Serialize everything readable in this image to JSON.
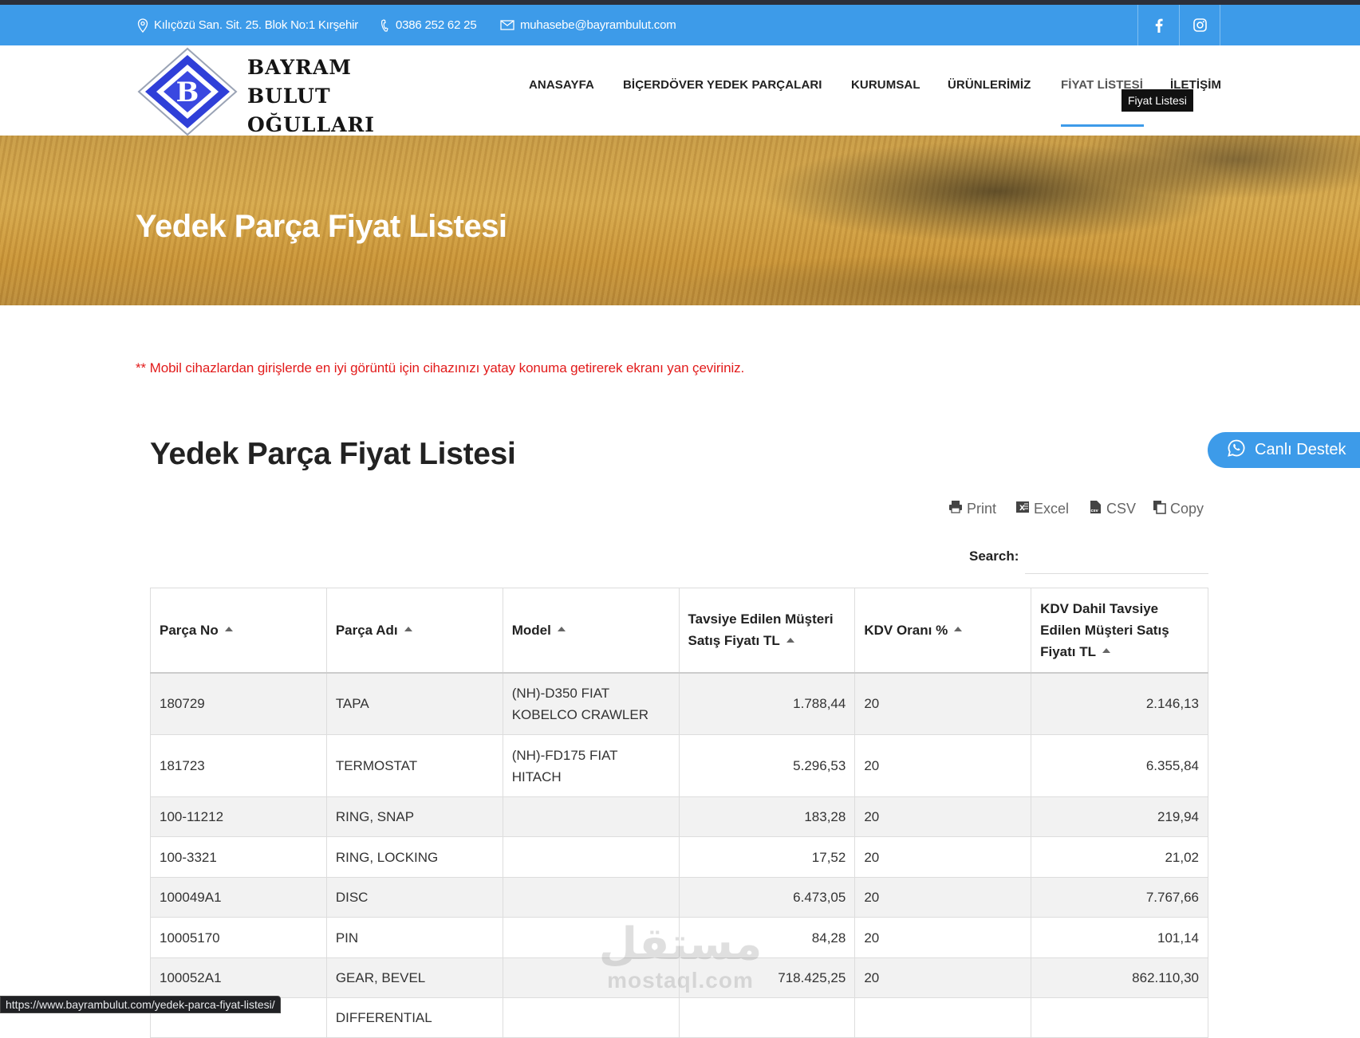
{
  "topbar": {
    "address": "Kılıçözü San. Sit. 25. Blok No:1 Kırşehir",
    "phone": "0386 252 62 25",
    "email": "muhasebe@bayrambulut.com",
    "social": [
      "facebook-icon",
      "instagram-icon"
    ]
  },
  "logo": {
    "letter": "B",
    "lines": [
      "BAYRAM",
      "BULUT",
      "OĞULLARI"
    ]
  },
  "nav": {
    "items": [
      "ANASAYFA",
      "BİÇERDÖVER YEDEK PARÇALARI",
      "KURUMSAL",
      "ÜRÜNLERİMİZ",
      "FİYAT LİSTESİ",
      "İLETİŞİM"
    ],
    "active": "FİYAT LİSTESİ",
    "tooltip": "Fiyat Listesi"
  },
  "hero": {
    "title": "Yedek Parça Fiyat Listesi"
  },
  "notice": "** Mobil cihazlardan girişlerde en iyi görüntü için cihazınızı yatay konuma getirerek ekranı yan çeviriniz.",
  "content": {
    "title": "Yedek Parça Fiyat Listesi"
  },
  "chat": {
    "label": "Canlı Destek"
  },
  "exports": {
    "print": "Print",
    "excel": "Excel",
    "csv": "CSV",
    "copy": "Copy"
  },
  "search": {
    "label": "Search:",
    "value": ""
  },
  "table": {
    "headers": [
      "Parça No",
      "Parça Adı",
      "Model",
      "Tavsiye Edilen Müşteri Satış Fiyatı TL",
      "KDV Oranı %",
      "KDV Dahil Tavsiye Edilen Müşteri Satış Fiyatı TL"
    ],
    "rows": [
      [
        "180729",
        "TAPA",
        "(NH)-D350 FIAT KOBELCO CRAWLER",
        "1.788,44",
        "20",
        "2.146,13"
      ],
      [
        "181723",
        "TERMOSTAT",
        "(NH)-FD175 FIAT HITACH",
        "5.296,53",
        "20",
        "6.355,84"
      ],
      [
        "100-11212",
        "RING, SNAP",
        "",
        "183,28",
        "20",
        "219,94"
      ],
      [
        "100-3321",
        "RING, LOCKING",
        "",
        "17,52",
        "20",
        "21,02"
      ],
      [
        "100049A1",
        "DISC",
        "",
        "6.473,05",
        "20",
        "7.767,66"
      ],
      [
        "10005170",
        "PIN",
        "",
        "84,28",
        "20",
        "101,14"
      ],
      [
        "100052A1",
        "GEAR, BEVEL",
        "",
        "718.425,25",
        "20",
        "862.110,30"
      ],
      [
        "",
        "DIFFERENTIAL",
        "",
        "",
        "",
        ""
      ]
    ]
  },
  "statusbar": "https://www.bayrambulut.com/yedek-parca-fiyat-listesi/",
  "watermark": {
    "arabic": "مستقل",
    "latin": "mostaql.com"
  },
  "colors": {
    "accent": "#3d9be9",
    "notice": "#e21b1b",
    "dark": "#2b2f3a"
  }
}
